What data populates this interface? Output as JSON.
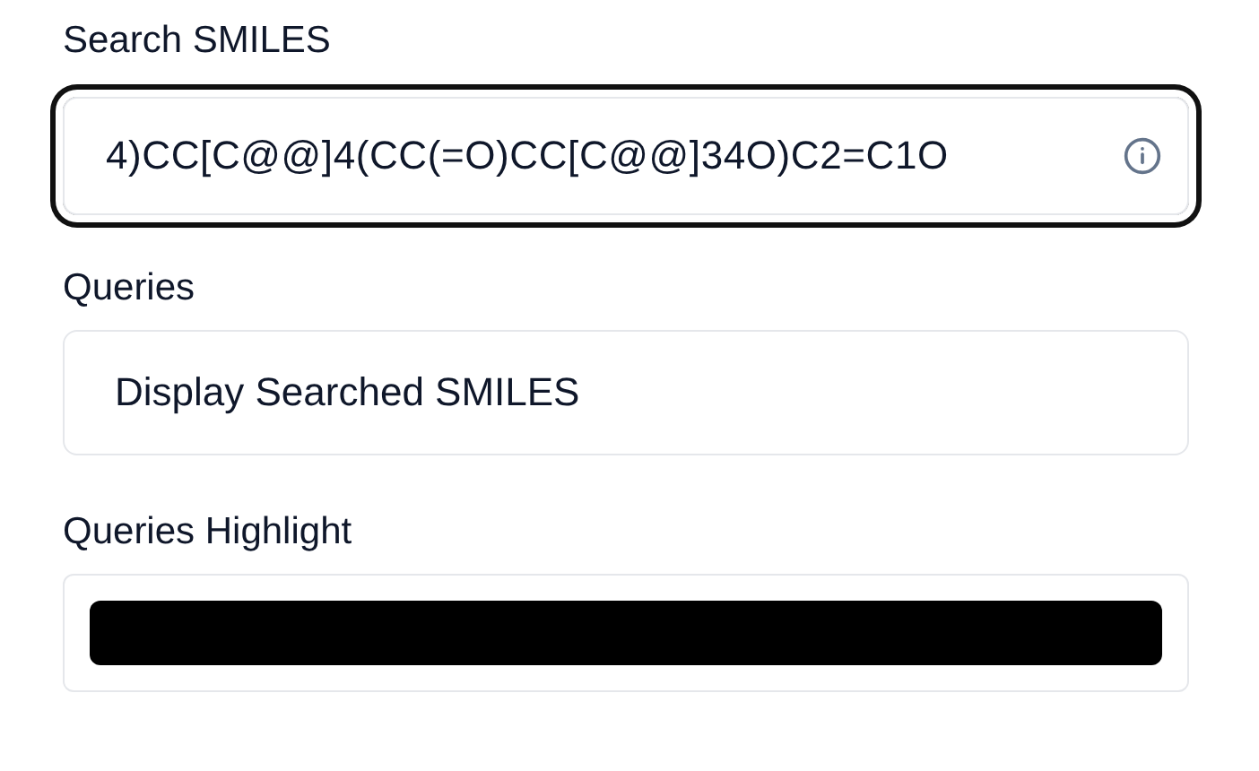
{
  "search_smiles": {
    "label": "Search SMILES",
    "value": "4)CC[C@@]4(CC(=O)CC[C@@]34O)C2=C1O",
    "focused": true
  },
  "queries": {
    "label": "Queries",
    "value": "Display Searched SMILES"
  },
  "queries_highlight": {
    "label": "Queries Highlight",
    "color": "#000000"
  }
}
